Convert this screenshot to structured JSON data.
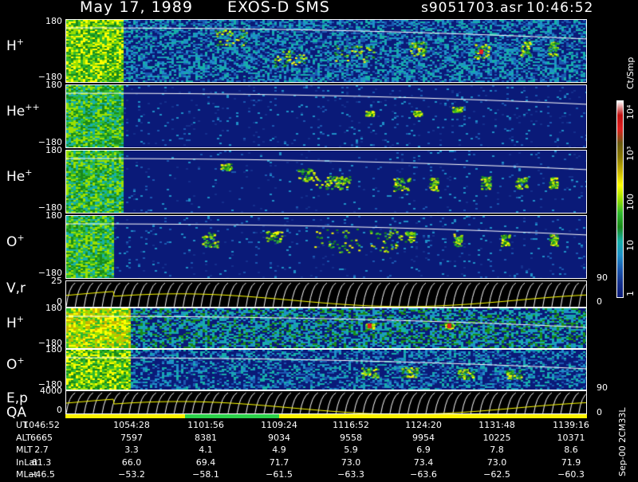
{
  "header": {
    "date": "May 17, 1989",
    "instrument": "EXOS-D SMS",
    "file": "s9051703.asr",
    "time": "10:46:52"
  },
  "panels": [
    {
      "name": "H+",
      "label_base": "H",
      "label_sup": "+",
      "ytop": "180",
      "ybot": "−180"
    },
    {
      "name": "He++",
      "label_base": "He",
      "label_sup": "++",
      "ytop": "180",
      "ybot": "−180"
    },
    {
      "name": "He+",
      "label_base": "He",
      "label_sup": "+",
      "ytop": "180",
      "ybot": "−180"
    },
    {
      "name": "O+",
      "label_base": "O",
      "label_sup": "+",
      "ytop": "180",
      "ybot": "−180"
    },
    {
      "name": "V,r",
      "label_base": "V,r",
      "label_sup": "",
      "ytop": "25",
      "ybot": "0",
      "rtop": "90",
      "rbot": "0"
    },
    {
      "name": "H+ (2)",
      "label_base": "H",
      "label_sup": "+",
      "ytop": "180",
      "ybot": "−180"
    },
    {
      "name": "O+ (2)",
      "label_base": "O",
      "label_sup": "+",
      "ytop": "180",
      "ybot": "−180"
    },
    {
      "name": "E,p",
      "label_base": "E,p",
      "label_sup": "",
      "ytop": "4000",
      "ybot": "0",
      "rtop": "90",
      "rbot": "0"
    }
  ],
  "qa_label": "QA",
  "colorbar": {
    "unit": "Ct/Smp",
    "ticks": [
      "10⁴",
      "10³",
      "100",
      "10",
      "1"
    ],
    "colors": [
      "#ffffff",
      "#c01010",
      "#e02020",
      "#6a5a10",
      "#8a7a00",
      "#c8b400",
      "#ffff00",
      "#9be000",
      "#2fb82f",
      "#1a8a1a",
      "#16b0a8",
      "#1e90c8",
      "#1a58b0",
      "#14308c",
      "#0a1a78"
    ]
  },
  "table": {
    "rows": [
      {
        "label": "UT",
        "values": [
          "1046:52",
          "1054:28",
          "1101:56",
          "1109:24",
          "1116:52",
          "1124:20",
          "1131:48",
          "1139:16"
        ]
      },
      {
        "label": "ALT",
        "values": [
          "6665",
          "7597",
          "8381",
          "9034",
          "9558",
          "9954",
          "10225",
          "10371"
        ]
      },
      {
        "label": "MLT",
        "values": [
          "2.7",
          "3.3",
          "4.1",
          "4.9",
          "5.9",
          "6.9",
          "7.8",
          "8.6"
        ]
      },
      {
        "label": "InLat",
        "values": [
          "61.3",
          "66.0",
          "69.4",
          "71.7",
          "73.0",
          "73.4",
          "73.0",
          "71.9"
        ]
      },
      {
        "label": "MLat",
        "values": [
          "−46.5",
          "−53.2",
          "−58.1",
          "−61.5",
          "−63.3",
          "−63.6",
          "−62.5",
          "−60.3"
        ]
      }
    ]
  },
  "footer": "Sep-00 2CM33L",
  "chart_data": {
    "type": "heatmap",
    "title": "May 17, 1989   EXOS-D SMS",
    "x_ticks": [
      "1046:52",
      "1054:28",
      "1101:56",
      "1109:24",
      "1116:52",
      "1124:20",
      "1131:48",
      "1139:16"
    ],
    "series": [
      {
        "name": "H+",
        "ylim": [
          -180,
          180
        ]
      },
      {
        "name": "He++",
        "ylim": [
          -180,
          180
        ]
      },
      {
        "name": "He+",
        "ylim": [
          -180,
          180
        ]
      },
      {
        "name": "O+",
        "ylim": [
          -180,
          180
        ]
      },
      {
        "name": "V,r",
        "ylim": [
          0,
          25
        ],
        "ylim_right": [
          0,
          90
        ]
      },
      {
        "name": "H+",
        "ylim": [
          -180,
          180
        ]
      },
      {
        "name": "O+",
        "ylim": [
          -180,
          180
        ]
      },
      {
        "name": "E,p",
        "ylim": [
          0,
          4000
        ],
        "ylim_right": [
          0,
          90
        ]
      }
    ],
    "colorbar": {
      "label": "Ct/Smp",
      "ticks": [
        "1",
        "10",
        "100",
        "10³",
        "10⁴"
      ]
    }
  }
}
